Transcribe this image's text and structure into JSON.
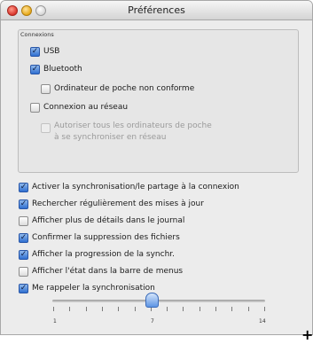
{
  "window": {
    "title": "Préférences"
  },
  "connexions": {
    "label": "Connexions",
    "items": [
      {
        "label": "USB",
        "checked": true
      },
      {
        "label": "Bluetooth",
        "checked": true
      },
      {
        "label": "Ordinateur de poche non conforme",
        "checked": false
      },
      {
        "label": "Connexion au réseau",
        "checked": false
      },
      {
        "label_line1": "Autoriser tous les ordinateurs de poche",
        "label_line2": "à se synchroniser en réseau",
        "checked": false,
        "disabled": true
      }
    ]
  },
  "options": [
    {
      "label": "Activer la synchronisation/le partage à la connexion",
      "checked": true
    },
    {
      "label": "Rechercher régulièrement des mises à jour",
      "checked": true
    },
    {
      "label": "Afficher plus de détails dans le journal",
      "checked": false
    },
    {
      "label": "Confirmer la suppression des fichiers",
      "checked": true
    },
    {
      "label": "Afficher la progression de la synchr.",
      "checked": true
    },
    {
      "label": "Afficher l'état dans la barre de menus",
      "checked": false
    },
    {
      "label": "Me rappeler la synchronisation",
      "checked": true
    }
  ],
  "reminder_slider": {
    "min_label": "1",
    "mid_label": "7",
    "max_label": "14",
    "value": 7
  },
  "add_label": "+"
}
